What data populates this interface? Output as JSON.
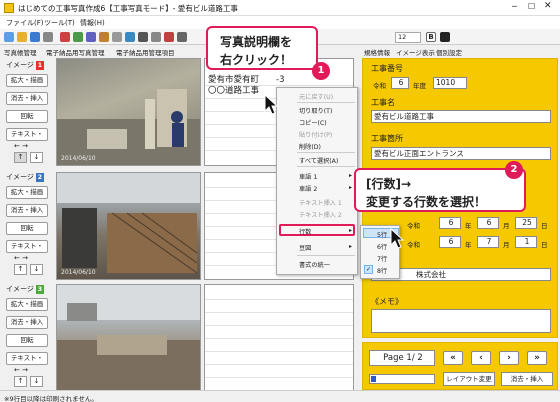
{
  "window": {
    "title": "はじめての工事写真作成6【工事写真モード】- 愛有ビル道路工事"
  },
  "menu": [
    "ファイル(F)",
    "ツール(T)",
    "情報(H)"
  ],
  "toolbar": {
    "font_size": "12"
  },
  "left_tabs": [
    "写真帳管理",
    "電子納品用写真管理",
    "電子納品用管理項目"
  ],
  "right_tabs": [
    "規格情報",
    "イメージ表示",
    "個別設定"
  ],
  "image_groups": [
    {
      "label": "イメージ",
      "num": "1",
      "color": "#e8312d",
      "buttons": [
        "拡大・描画",
        "消去・挿入",
        "回転",
        "テキスト・"
      ],
      "photo_date": "2014/06/10"
    },
    {
      "label": "イメージ",
      "num": "2",
      "color": "#3b74c7",
      "buttons": [
        "拡大・描画",
        "消去・挿入",
        "回転",
        "テキスト・"
      ],
      "photo_date": "2014/06/10"
    },
    {
      "label": "イメージ",
      "num": "3",
      "color": "#4daa3a",
      "buttons": [
        "拡大・描画",
        "消去・挿入",
        "回転",
        "テキスト・"
      ],
      "photo_date": ""
    }
  ],
  "description": {
    "line1": "愛有市愛有町　　-3",
    "line2": "〇〇道路工事"
  },
  "context_menu": {
    "items": [
      "元に戻す(U)",
      "切り取り(T)",
      "コピー(C)",
      "貼り付け(P)",
      "削除(D)",
      "すべて選択(A)",
      "車語 1",
      "車語 2",
      "テキスト挿入 1",
      "テキスト挿入 2",
      "行数",
      "豆図",
      "書式の統一"
    ],
    "disabled": [
      0,
      3,
      8,
      9
    ]
  },
  "submenu": {
    "items": [
      "5行",
      "6行",
      "7行",
      "8行"
    ],
    "checked": "8行"
  },
  "form": {
    "kouji_bangou_label": "工事番号",
    "reiwa": "令和",
    "year": "6",
    "nendo": "年度",
    "code": "1010",
    "kouji_mei_label": "工事名",
    "kouji_mei": "愛有ビル道路工事",
    "kouji_kasho_label": "工事箇所",
    "kouji_kasho": "愛有ビル正面エントランス",
    "period_from": {
      "reiwa": "令和",
      "y": "6",
      "m": "6",
      "d": "25"
    },
    "period_to": {
      "reiwa": "令和",
      "y": "6",
      "m": "7",
      "d": "1"
    },
    "nen": "年",
    "tsuki": "月",
    "nichi": "日",
    "company": "株式会社",
    "memo_label": "《メモ》"
  },
  "pager": {
    "page": "Page 1/ 2",
    "layout_btn": "レイアウト変更",
    "erase_btn": "消去・挿入"
  },
  "callouts": {
    "c1_line1": "写真説明欄を",
    "c1_line2": "右クリック！",
    "c1_num": "1",
    "c2_line1": "[行数]→",
    "c2_line2": "変更する行数を選択！",
    "c2_num": "2"
  },
  "status": "※9行目以降は印刷されません。"
}
